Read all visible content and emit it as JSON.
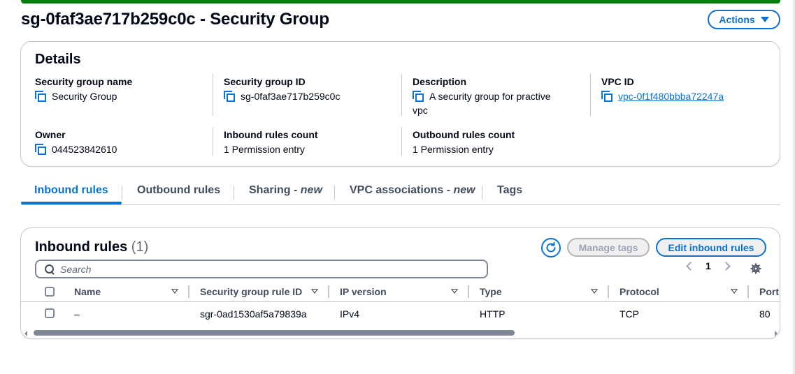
{
  "header": {
    "title": "sg-0faf3ae717b259c0c - Security Group",
    "actions_label": "Actions"
  },
  "details": {
    "title": "Details",
    "fields": {
      "name": {
        "label": "Security group name",
        "value": "Security Group"
      },
      "id": {
        "label": "Security group ID",
        "value": "sg-0faf3ae717b259c0c"
      },
      "description": {
        "label": "Description",
        "value_line1": "A security group for practive",
        "value_line2": "vpc"
      },
      "vpc": {
        "label": "VPC ID",
        "value": "vpc-0f1f480bbba72247a"
      },
      "owner": {
        "label": "Owner",
        "value": "044523842610"
      },
      "inbound_count": {
        "label": "Inbound rules count",
        "value": "1 Permission entry"
      },
      "outbound_count": {
        "label": "Outbound rules count",
        "value": "1 Permission entry"
      }
    }
  },
  "tabs": [
    {
      "label": "Inbound rules",
      "suffix": "",
      "active": true
    },
    {
      "label": "Outbound rules",
      "suffix": ""
    },
    {
      "label": "Sharing - ",
      "suffix": "new"
    },
    {
      "label": "VPC associations - ",
      "suffix": "new"
    },
    {
      "label": "Tags",
      "suffix": ""
    }
  ],
  "inbound_rules": {
    "title": "Inbound rules",
    "count": "(1)",
    "manage_tags_label": "Manage tags",
    "edit_label": "Edit inbound rules",
    "search_placeholder": "Search",
    "page": "1",
    "columns": [
      "Name",
      "Security group rule ID",
      "IP version",
      "Type",
      "Protocol",
      "Port"
    ],
    "rows": [
      {
        "name": "–",
        "rule_id": "sgr-0ad1530af5a79839a",
        "ip_version": "IPv4",
        "type": "HTTP",
        "protocol": "TCP",
        "port": "80"
      }
    ]
  },
  "colors": {
    "accent": "#0972d3",
    "success_strip": "#037f0c",
    "border": "#c6c6cd"
  },
  "icons": [
    "copy-icon",
    "chevron-down-icon",
    "refresh-icon",
    "search-icon",
    "chevron-left-icon",
    "chevron-right-icon",
    "gear-icon",
    "sort-icon"
  ]
}
